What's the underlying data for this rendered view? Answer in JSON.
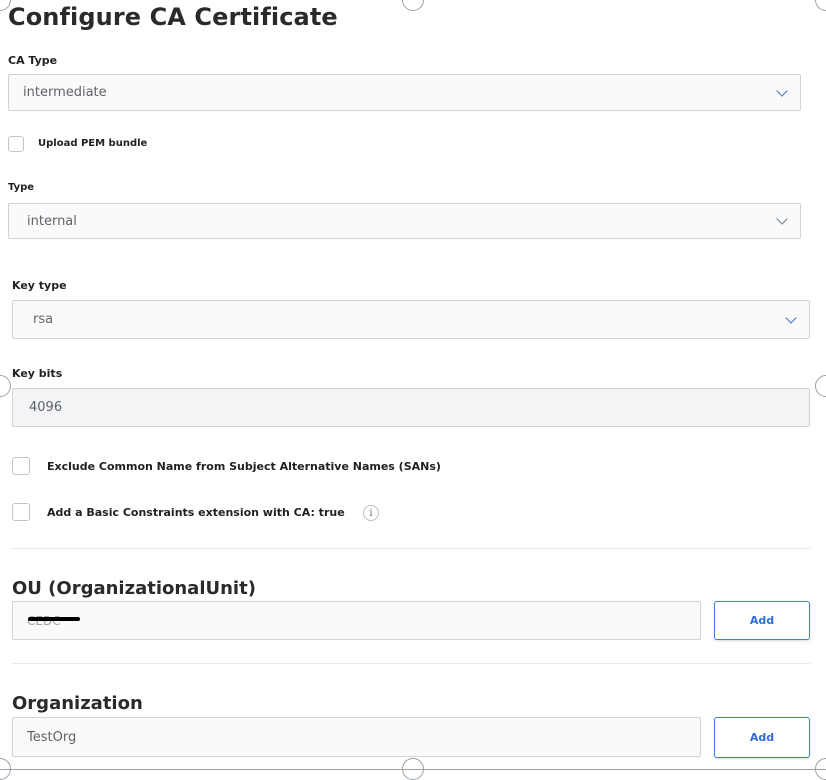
{
  "page": {
    "title": "Configure CA Certificate"
  },
  "ca_type": {
    "label": "CA Type",
    "value": "intermediate"
  },
  "upload_pem": {
    "label": "Upload PEM bundle",
    "checked": false
  },
  "type": {
    "label": "Type",
    "value": "internal"
  },
  "key_type": {
    "label": "Key type",
    "value": "rsa"
  },
  "key_bits": {
    "label": "Key bits",
    "value": "4096"
  },
  "exclude_cn": {
    "label": "Exclude Common Name from Subject Alternative Names (SANs)",
    "checked": false
  },
  "basic_constraints": {
    "label": "Add a Basic Constraints extension with CA: true",
    "checked": false,
    "info_glyph": "i"
  },
  "ou": {
    "heading": "OU (OrganizationalUnit)",
    "value": "CEDC",
    "value_redacted": true,
    "add_label": "Add"
  },
  "organization": {
    "heading": "Organization",
    "value": "TestOrg",
    "add_label": "Add"
  },
  "colors": {
    "accent": "#3f7de0",
    "border": "#cfd3d8",
    "text": "#222222"
  },
  "icons": {
    "dropdown": "chevron-down-icon",
    "info": "info-icon",
    "resize": "resize-handle-icon"
  }
}
